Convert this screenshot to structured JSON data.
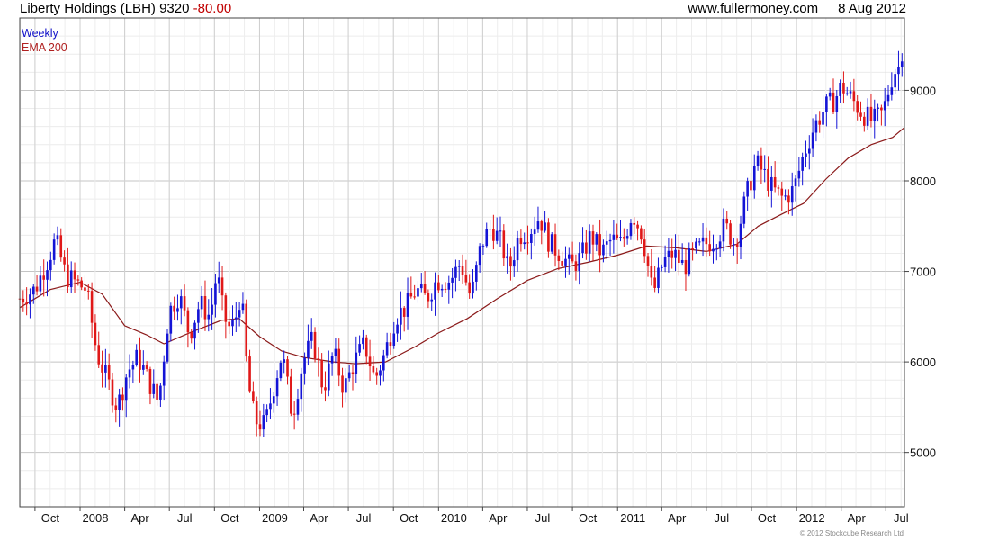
{
  "header": {
    "title": "Liberty Holdings (LBH)",
    "last_price": "9320",
    "change": "-80.00",
    "website": "www.fullermoney.com",
    "date": "8 Aug 2012"
  },
  "legend": {
    "series": "Weekly",
    "overlay": "EMA 200"
  },
  "copyright": "© 2012 Stockcube Research Ltd",
  "colors": {
    "up": "#1414d6",
    "down": "#e01818",
    "ema": "#8b1a1a",
    "grid": "#d4d4d4",
    "frame": "#444444"
  },
  "chart_data": {
    "type": "candlestick",
    "interval": "weekly",
    "grid": true,
    "y_axis_side": "right",
    "ylim": [
      4400,
      9800
    ],
    "yticks": [
      5000,
      6000,
      7000,
      8000,
      9000
    ],
    "x_tick_labels": [
      "Oct",
      "2008",
      "Apr",
      "Jul",
      "Oct",
      "2009",
      "Apr",
      "Jul",
      "Oct",
      "2010",
      "Apr",
      "Jul",
      "Oct",
      "2011",
      "Apr",
      "Jul",
      "Oct",
      "2012",
      "Apr",
      "Jul"
    ],
    "x_tick_months": [
      "2007-10",
      "2008-01",
      "2008-04",
      "2008-07",
      "2008-10",
      "2009-01",
      "2009-04",
      "2009-07",
      "2009-10",
      "2010-01",
      "2010-04",
      "2010-07",
      "2010-10",
      "2011-01",
      "2011-04",
      "2011-07",
      "2011-10",
      "2012-01",
      "2012-04",
      "2012-07"
    ],
    "range": {
      "start": "2007-08-31",
      "end": "2012-08-08"
    },
    "close_anchors": [
      [
        "2007-08-31",
        6700
      ],
      [
        "2007-10-01",
        6800
      ],
      [
        "2007-10-29",
        7150
      ],
      [
        "2007-11-12",
        7350
      ],
      [
        "2007-12-03",
        6950
      ],
      [
        "2008-01-14",
        6800
      ],
      [
        "2008-02-04",
        6100
      ],
      [
        "2008-02-25",
        5800
      ],
      [
        "2008-03-17",
        5500
      ],
      [
        "2008-04-07",
        5900
      ],
      [
        "2008-04-28",
        6050
      ],
      [
        "2008-05-19",
        5800
      ],
      [
        "2008-06-09",
        5550
      ],
      [
        "2008-06-30",
        6550
      ],
      [
        "2008-07-21",
        6750
      ],
      [
        "2008-08-11",
        6300
      ],
      [
        "2008-09-01",
        6650
      ],
      [
        "2008-09-22",
        6500
      ],
      [
        "2008-10-06",
        7000
      ],
      [
        "2008-10-20",
        6500
      ],
      [
        "2008-11-03",
        6350
      ],
      [
        "2008-11-17",
        6550
      ],
      [
        "2008-11-24",
        6800
      ],
      [
        "2008-12-08",
        5800
      ],
      [
        "2008-12-22",
        5350
      ],
      [
        "2009-01-12",
        5300
      ],
      [
        "2009-02-02",
        5800
      ],
      [
        "2009-02-16",
        6100
      ],
      [
        "2009-03-09",
        5400
      ],
      [
        "2009-03-30",
        6000
      ],
      [
        "2009-04-20",
        6250
      ],
      [
        "2009-05-11",
        5700
      ],
      [
        "2009-06-01",
        6100
      ],
      [
        "2009-06-22",
        5700
      ],
      [
        "2009-07-13",
        6000
      ],
      [
        "2009-08-03",
        6200
      ],
      [
        "2009-08-24",
        5800
      ],
      [
        "2009-09-14",
        6100
      ],
      [
        "2009-10-05",
        6500
      ],
      [
        "2009-10-26",
        6600
      ],
      [
        "2009-11-16",
        6800
      ],
      [
        "2009-12-07",
        6700
      ],
      [
        "2009-12-28",
        6900
      ],
      [
        "2010-01-25",
        6900
      ],
      [
        "2010-02-15",
        7100
      ],
      [
        "2010-03-08",
        6700
      ],
      [
        "2010-03-29",
        7300
      ],
      [
        "2010-04-19",
        7500
      ],
      [
        "2010-05-10",
        7300
      ],
      [
        "2010-05-24",
        7000
      ],
      [
        "2010-06-14",
        7400
      ],
      [
        "2010-07-05",
        7450
      ],
      [
        "2010-07-26",
        7600
      ],
      [
        "2010-08-16",
        7300
      ],
      [
        "2010-09-06",
        7200
      ],
      [
        "2010-09-27",
        7050
      ],
      [
        "2010-10-18",
        7150
      ],
      [
        "2010-11-08",
        7400
      ],
      [
        "2010-11-29",
        7200
      ],
      [
        "2010-12-20",
        7350
      ],
      [
        "2011-01-10",
        7300
      ],
      [
        "2011-01-31",
        7650
      ],
      [
        "2011-02-21",
        7400
      ],
      [
        "2011-03-14",
        6750
      ],
      [
        "2011-04-04",
        7100
      ],
      [
        "2011-04-25",
        7200
      ],
      [
        "2011-05-16",
        7050
      ],
      [
        "2011-06-06",
        7200
      ],
      [
        "2011-06-27",
        7300
      ],
      [
        "2011-07-18",
        7350
      ],
      [
        "2011-08-08",
        7500
      ],
      [
        "2011-08-29",
        7300
      ],
      [
        "2011-09-19",
        7800
      ],
      [
        "2011-10-10",
        8200
      ],
      [
        "2011-10-24",
        8100
      ],
      [
        "2011-11-14",
        7900
      ],
      [
        "2011-12-05",
        7800
      ],
      [
        "2011-12-26",
        7900
      ],
      [
        "2012-01-16",
        8300
      ],
      [
        "2012-02-06",
        8600
      ],
      [
        "2012-02-27",
        8800
      ],
      [
        "2012-03-19",
        8900
      ],
      [
        "2012-04-02",
        9050
      ],
      [
        "2012-04-23",
        8900
      ],
      [
        "2012-05-14",
        8750
      ],
      [
        "2012-06-04",
        8650
      ],
      [
        "2012-06-25",
        8750
      ],
      [
        "2012-07-16",
        9200
      ],
      [
        "2012-08-08",
        9320
      ]
    ],
    "ema_anchors": [
      [
        "2007-08-31",
        6600
      ],
      [
        "2007-11-01",
        6800
      ],
      [
        "2008-01-01",
        6880
      ],
      [
        "2008-02-15",
        6750
      ],
      [
        "2008-04-01",
        6400
      ],
      [
        "2008-05-15",
        6300
      ],
      [
        "2008-06-20",
        6200
      ],
      [
        "2008-08-15",
        6330
      ],
      [
        "2008-10-15",
        6460
      ],
      [
        "2008-11-20",
        6480
      ],
      [
        "2009-01-01",
        6280
      ],
      [
        "2009-02-15",
        6120
      ],
      [
        "2009-04-01",
        6050
      ],
      [
        "2009-06-01",
        6000
      ],
      [
        "2009-07-15",
        5980
      ],
      [
        "2009-09-15",
        6000
      ],
      [
        "2009-11-15",
        6170
      ],
      [
        "2010-01-01",
        6320
      ],
      [
        "2010-03-01",
        6480
      ],
      [
        "2010-05-01",
        6700
      ],
      [
        "2010-07-01",
        6900
      ],
      [
        "2010-09-01",
        7030
      ],
      [
        "2010-11-01",
        7100
      ],
      [
        "2011-01-01",
        7180
      ],
      [
        "2011-03-01",
        7280
      ],
      [
        "2011-05-01",
        7260
      ],
      [
        "2011-07-01",
        7220
      ],
      [
        "2011-09-01",
        7300
      ],
      [
        "2011-10-15",
        7500
      ],
      [
        "2011-12-01",
        7630
      ],
      [
        "2012-01-15",
        7750
      ],
      [
        "2012-03-01",
        8020
      ],
      [
        "2012-04-15",
        8250
      ],
      [
        "2012-06-01",
        8400
      ],
      [
        "2012-07-15",
        8480
      ],
      [
        "2012-08-08",
        8590
      ]
    ]
  }
}
